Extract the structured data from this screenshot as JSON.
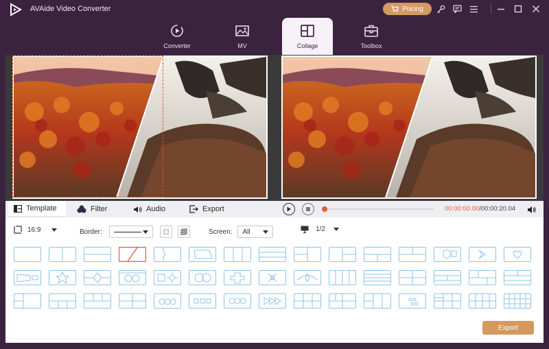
{
  "app": {
    "title": "AVAide Video Converter",
    "pricing_label": "Pricing"
  },
  "nav": [
    {
      "label": "Converter",
      "icon": "converter-icon",
      "active": false
    },
    {
      "label": "MV",
      "icon": "mv-image-icon",
      "active": false
    },
    {
      "label": "Collage",
      "icon": "collage-icon",
      "active": true
    },
    {
      "label": "Toolbox",
      "icon": "toolbox-icon",
      "active": false
    }
  ],
  "tabs": [
    {
      "label": "Template",
      "icon": "template-icon",
      "active": true
    },
    {
      "label": "Filter",
      "icon": "filter-icon",
      "active": false
    },
    {
      "label": "Audio",
      "icon": "audio-icon",
      "active": false
    },
    {
      "label": "Export",
      "icon": "export-icon",
      "active": false
    }
  ],
  "player": {
    "current_time": "00:00:00.00",
    "total_time": "/00:00:20.04",
    "progress": 0.0
  },
  "options": {
    "aspect": "16:9",
    "border_label": "Border:",
    "screen_label": "Screen:",
    "screen_value": "All",
    "page_value": "1/2"
  },
  "export_label": "Export",
  "colors": {
    "accent": "#d49960",
    "highlight": "#e65a3b",
    "template_stroke": "#8ec3e6",
    "bg": "#3b2340"
  },
  "templates_selected_index": 3
}
